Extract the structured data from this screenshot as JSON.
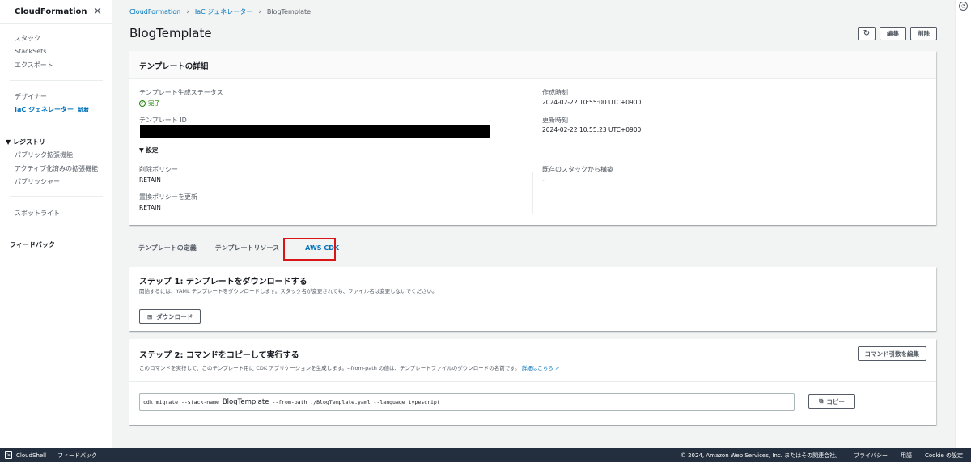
{
  "sidebar": {
    "title": "CloudFormation",
    "items": [
      "スタック",
      "StackSets",
      "エクスポート"
    ],
    "items2": [
      "デザイナー",
      "IaC ジェネレーター"
    ],
    "new_badge": "新着",
    "registry_label": "レジストリ",
    "registry_items": [
      "パブリック拡張機能",
      "アクティブ化済みの拡張機能",
      "パブリッシャー"
    ],
    "spotlight": "スポットライト",
    "feedback": "フィードバック"
  },
  "breadcrumb": [
    "CloudFormation",
    "IaC ジェネレーター",
    "BlogTemplate"
  ],
  "page_title": "BlogTemplate",
  "header_buttons": {
    "edit": "編集",
    "delete": "削除",
    "refresh_icon": "↻"
  },
  "details": {
    "title": "テンプレートの詳細",
    "status_label": "テンプレート生成ステータス",
    "status_value": "完了",
    "id_label": "テンプレート ID",
    "settings_label": "設定",
    "deletion_policy_label": "削除ポリシー",
    "deletion_policy_value": "RETAIN",
    "replace_policy_label": "置換ポリシーを更新",
    "replace_policy_value": "RETAIN",
    "created_label": "作成時刻",
    "created_value": "2024-02-22 10:55:00 UTC+0900",
    "updated_label": "更新時刻",
    "updated_value": "2024-02-22 10:55:23 UTC+0900",
    "existing_stack_label": "既存のスタックから構築",
    "existing_stack_value": "-"
  },
  "tabs": [
    "テンプレートの定義",
    "テンプレートリソース",
    "AWS CDK"
  ],
  "step1": {
    "title": "ステップ 1: テンプレートをダウンロードする",
    "desc": "開始するには、YAML テンプレートをダウンロードします。スタック名が変更されても、ファイル名は変更しないでください。",
    "button": "ダウンロード"
  },
  "step2": {
    "title": "ステップ 2: コマンドをコピーして実行する",
    "desc": "このコマンドを実行して、このテンプレート用に CDK アプリケーションを生成します。--from-path の値は、テンプレートファイルのダウンロードの名前です。",
    "learn_more": "詳細はこちら",
    "edit_args_button": "コマンド引数を編集",
    "cmd_prefix": "cdk migrate --stack-name ",
    "cmd_name": "BlogTemplate",
    "cmd_suffix": " --from-path ./BlogTemplate.yaml --language typescript",
    "copy_button": "コピー"
  },
  "footer": {
    "cloudshell": "CloudShell",
    "feedback": "フィードバック",
    "copyright": "© 2024, Amazon Web Services, Inc. またはその関連会社。",
    "privacy": "プライバシー",
    "terms": "用語",
    "cookie": "Cookie の設定"
  }
}
